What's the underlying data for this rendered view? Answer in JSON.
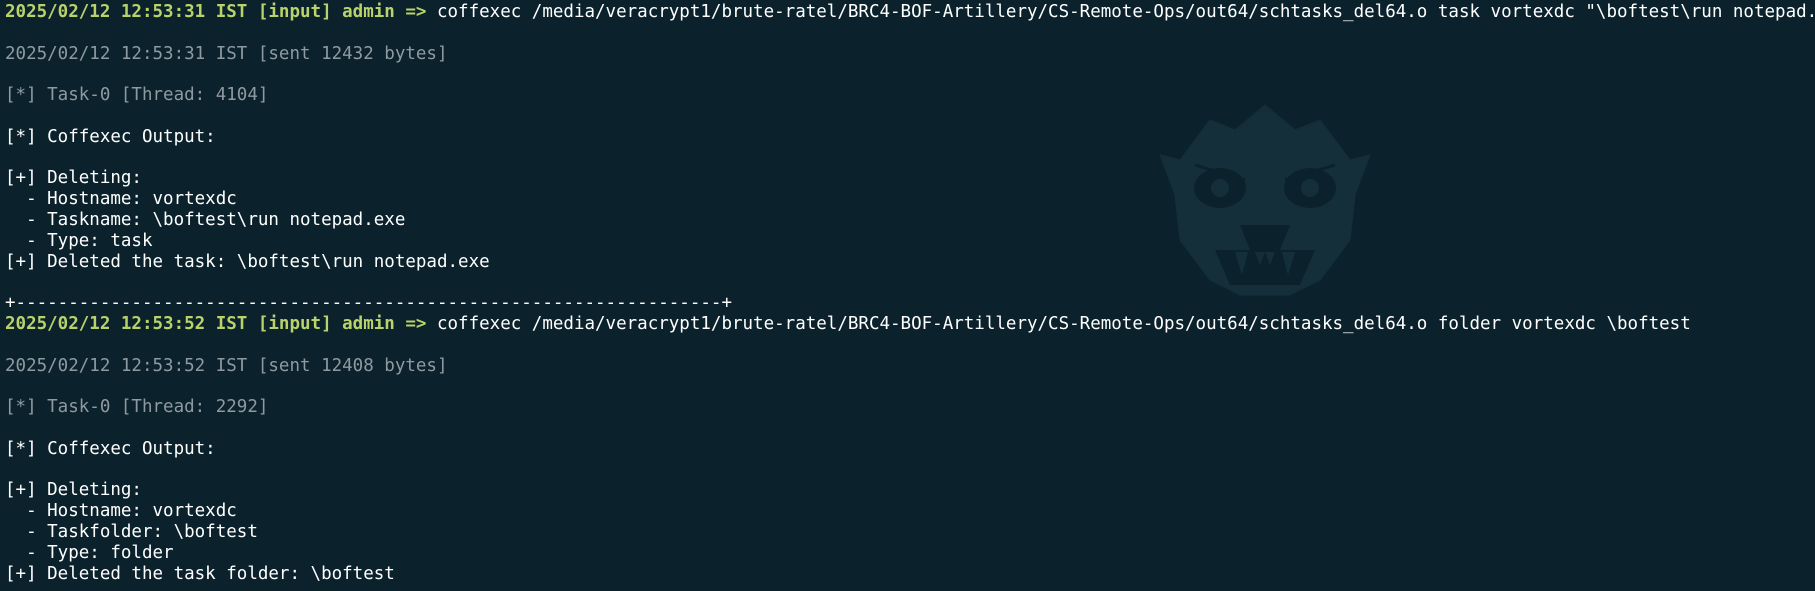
{
  "colors": {
    "background": "#0b222c",
    "prompt": "#b9d36a",
    "dim_text": "#8f9aa0",
    "output_text": "#ffffff"
  },
  "watermark_icon": "badger-head-icon",
  "session1": {
    "prompt": "2025/02/12 12:53:31 IST [input] admin =>",
    "command": " coffexec /media/veracrypt1/brute-ratel/BRC4-BOF-Artillery/CS-Remote-Ops/out64/schtasks_del64.o task vortexdc \"\\boftest\\run notepad.exe\"",
    "sent": "2025/02/12 12:53:31 IST [sent 12432 bytes]",
    "task": "[*] Task-0 [Thread: 4104]",
    "output_header": "[*] Coffexec Output:",
    "deleting": "[+] Deleting:",
    "hostname": "  - Hostname: vortexdc",
    "taskname": "  - Taskname: \\boftest\\run notepad.exe",
    "type": "  - Type: task",
    "result": "[+] Deleted the task: \\boftest\\run notepad.exe"
  },
  "separator": "+-------------------------------------------------------------------+",
  "session2": {
    "prompt": "2025/02/12 12:53:52 IST [input] admin =>",
    "command": " coffexec /media/veracrypt1/brute-ratel/BRC4-BOF-Artillery/CS-Remote-Ops/out64/schtasks_del64.o folder vortexdc \\boftest",
    "sent": "2025/02/12 12:53:52 IST [sent 12408 bytes]",
    "task": "[*] Task-0 [Thread: 2292]",
    "output_header": "[*] Coffexec Output:",
    "deleting": "[+] Deleting:",
    "hostname": "  - Hostname: vortexdc",
    "taskfolder": "  - Taskfolder: \\boftest",
    "type": "  - Type: folder",
    "result": "[+] Deleted the task folder: \\boftest"
  }
}
